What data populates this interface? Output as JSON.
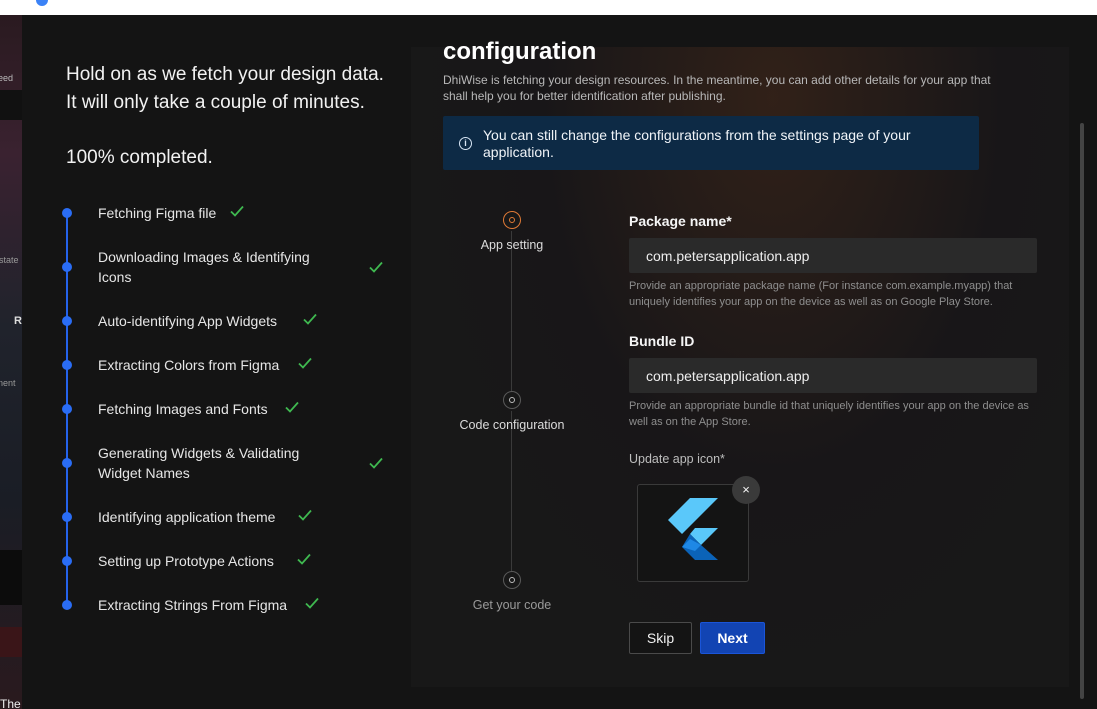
{
  "background_page": {
    "fragments": [
      "eed",
      "state",
      "R",
      "nent",
      "The"
    ]
  },
  "left": {
    "title": "Hold on as we fetch your design data. It will only take a couple of minutes.",
    "progress": "100% completed.",
    "steps": [
      {
        "label": "Fetching Figma file"
      },
      {
        "label": "Downloading Images & Identifying Icons"
      },
      {
        "label": "Auto-identifying App Widgets"
      },
      {
        "label": "Extracting Colors from Figma"
      },
      {
        "label": "Fetching Images and Fonts"
      },
      {
        "label": "Generating Widgets & Validating Widget Names"
      },
      {
        "label": "Identifying application theme"
      },
      {
        "label": "Setting up Prototype Actions"
      },
      {
        "label": "Extracting Strings From Figma"
      }
    ]
  },
  "right": {
    "title": "configuration",
    "description": "DhiWise is fetching your design resources. In the meantime, you can add other details for your app that shall help you for better identification after publishing.",
    "info_banner": "You can still change the configurations from the settings page of your application.",
    "wizard_steps": [
      "App setting",
      "Code configuration",
      "Get your code"
    ],
    "package_name": {
      "label": "Package name*",
      "value": "com.petersapplication.app",
      "hint": "Provide an appropriate package name (For instance com.example.myapp) that uniquely identifies your app on the device as well as on Google Play Store."
    },
    "bundle_id": {
      "label": "Bundle ID",
      "value": "com.petersapplication.app",
      "hint": "Provide an appropriate bundle id that uniquely identifies your app on the device as well as on the App Store."
    },
    "app_icon": {
      "label": "Update app icon*",
      "icon": "flutter-logo",
      "remove": "×"
    },
    "buttons": {
      "skip": "Skip",
      "next": "Next"
    }
  },
  "colors": {
    "accent_blue": "#1244b3",
    "timeline_blue": "#2a6df5",
    "check_green": "#3fb950",
    "active_step_orange": "#e07a36",
    "info_bg": "#0d2a45"
  }
}
